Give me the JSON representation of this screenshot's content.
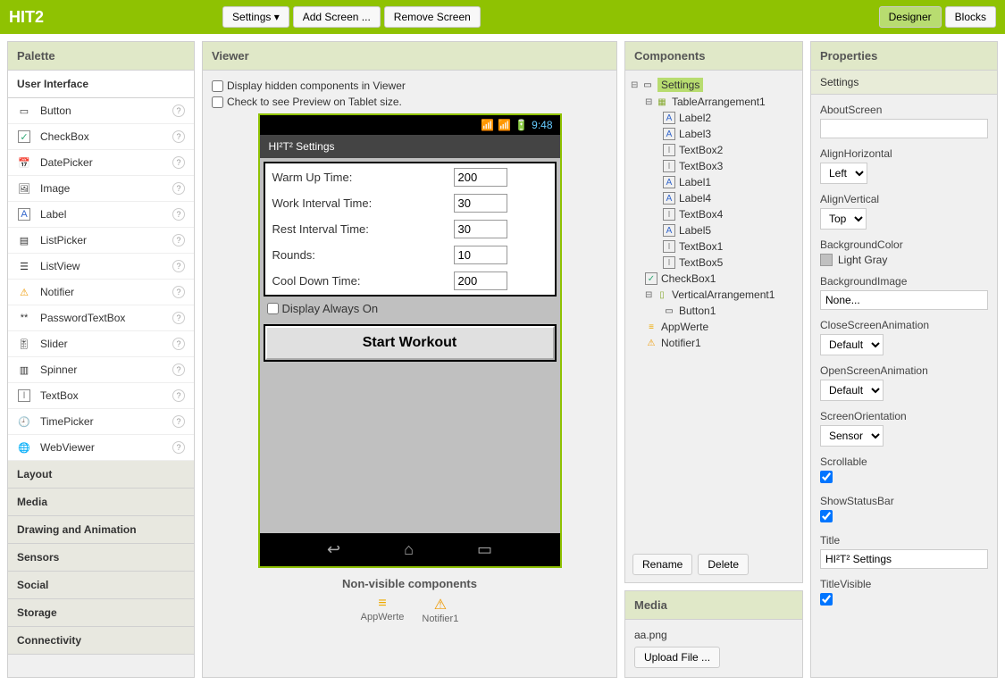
{
  "topbar": {
    "title": "HIT2",
    "settings_btn": "Settings ▾",
    "add_screen_btn": "Add Screen ...",
    "remove_screen_btn": "Remove Screen",
    "designer_btn": "Designer",
    "blocks_btn": "Blocks"
  },
  "palette": {
    "header": "Palette",
    "sections": {
      "user_interface": "User Interface",
      "layout": "Layout",
      "media": "Media",
      "drawing": "Drawing and Animation",
      "sensors": "Sensors",
      "social": "Social",
      "storage": "Storage",
      "connectivity": "Connectivity"
    },
    "items": [
      {
        "label": "Button"
      },
      {
        "label": "CheckBox"
      },
      {
        "label": "DatePicker"
      },
      {
        "label": "Image"
      },
      {
        "label": "Label"
      },
      {
        "label": "ListPicker"
      },
      {
        "label": "ListView"
      },
      {
        "label": "Notifier"
      },
      {
        "label": "PasswordTextBox"
      },
      {
        "label": "Slider"
      },
      {
        "label": "Spinner"
      },
      {
        "label": "TextBox"
      },
      {
        "label": "TimePicker"
      },
      {
        "label": "WebViewer"
      }
    ]
  },
  "viewer": {
    "header": "Viewer",
    "hidden_check": "Display hidden components in Viewer",
    "tablet_check": "Check to see Preview on Tablet size.",
    "phone_time": "9:48",
    "phone_title": "HI²T² Settings",
    "rows": [
      {
        "label": "Warm Up Time:",
        "value": "200"
      },
      {
        "label": "Work Interval Time:",
        "value": "30"
      },
      {
        "label": "Rest Interval Time:",
        "value": "30"
      },
      {
        "label": "Rounds:",
        "value": "10"
      },
      {
        "label": "Cool Down Time:",
        "value": "200"
      }
    ],
    "display_always": "Display Always On",
    "start_button": "Start Workout",
    "nonvisible_title": "Non-visible components",
    "nonvisible": [
      {
        "label": "AppWerte"
      },
      {
        "label": "Notifier1"
      }
    ]
  },
  "components": {
    "header": "Components",
    "rename_btn": "Rename",
    "delete_btn": "Delete",
    "tree": {
      "root": "Settings",
      "table": "TableArrangement1",
      "table_children": [
        "Label2",
        "Label3",
        "TextBox2",
        "TextBox3",
        "Label1",
        "Label4",
        "TextBox4",
        "Label5",
        "TextBox1",
        "TextBox5"
      ],
      "checkbox": "CheckBox1",
      "vert": "VerticalArrangement1",
      "button": "Button1",
      "appwerte": "AppWerte",
      "notifier": "Notifier1"
    }
  },
  "media_panel": {
    "header": "Media",
    "file": "aa.png",
    "upload_btn": "Upload File ..."
  },
  "properties": {
    "header": "Properties",
    "target": "Settings",
    "fields": {
      "about_screen": "AboutScreen",
      "about_screen_val": "",
      "align_h": "AlignHorizontal",
      "align_h_val": "Left",
      "align_v": "AlignVertical",
      "align_v_val": "Top",
      "bg_color": "BackgroundColor",
      "bg_color_val": "Light Gray",
      "bg_image": "BackgroundImage",
      "bg_image_val": "None...",
      "close_anim": "CloseScreenAnimation",
      "close_anim_val": "Default",
      "open_anim": "OpenScreenAnimation",
      "open_anim_val": "Default",
      "orientation": "ScreenOrientation",
      "orientation_val": "Sensor",
      "scrollable": "Scrollable",
      "show_status": "ShowStatusBar",
      "title": "Title",
      "title_val": "HI²T² Settings",
      "title_visible": "TitleVisible"
    }
  }
}
